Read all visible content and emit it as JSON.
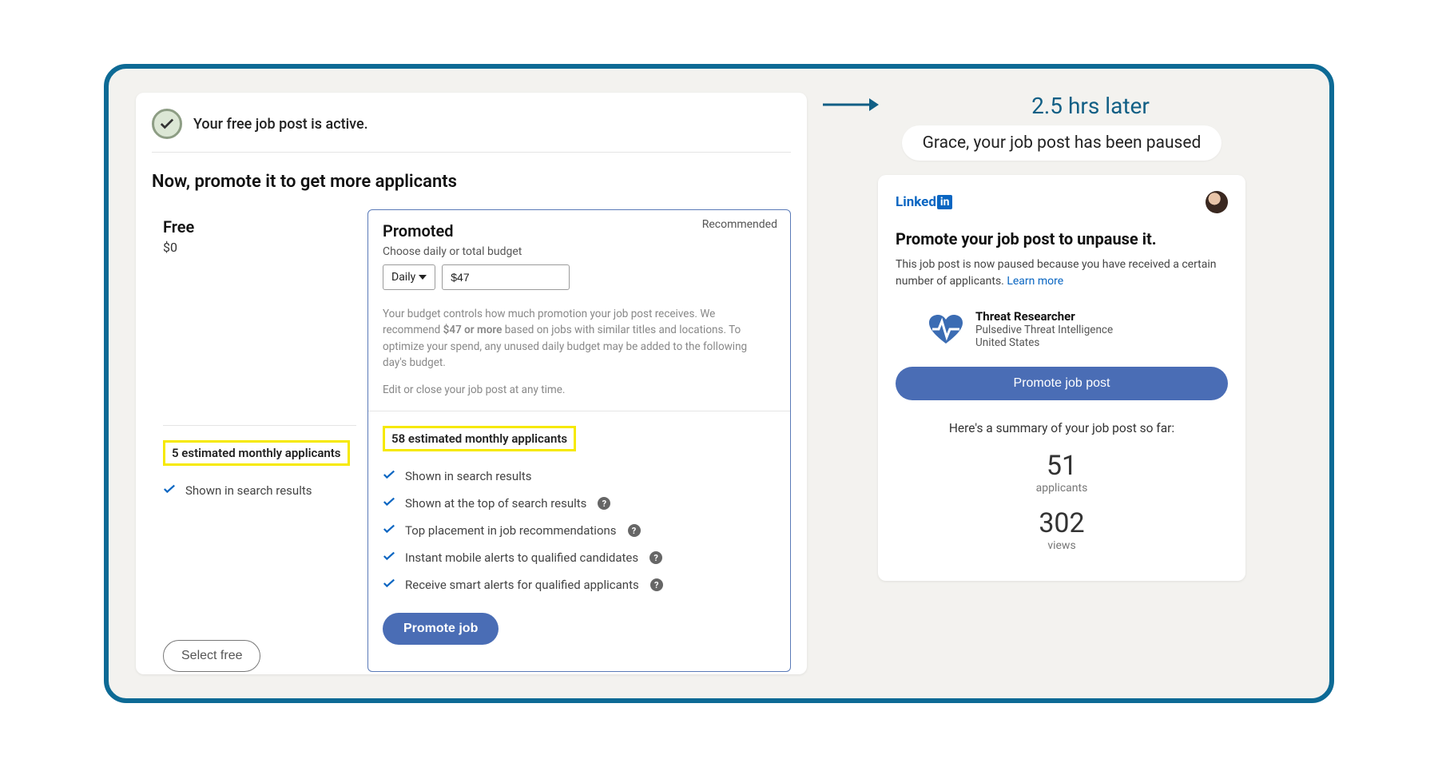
{
  "left": {
    "status_text": "Your free job post is active.",
    "heading": "Now, promote it to get more applicants",
    "free": {
      "title": "Free",
      "price": "$0",
      "estimate": "5 estimated monthly applicants",
      "features": [
        "Shown in search results"
      ],
      "button": "Select free"
    },
    "promoted": {
      "recommended": "Recommended",
      "title": "Promoted",
      "budget_label": "Choose daily or total budget",
      "budget_mode": "Daily",
      "budget_value": "$47",
      "budget_desc_pre": "Your budget controls how much promotion your job post receives. We recommend ",
      "budget_desc_bold": "$47 or more",
      "budget_desc_post": " based on jobs with similar titles and locations. To optimize your spend, any unused daily budget may be added to the following day's budget.",
      "edit_close": "Edit or close your job post at any time.",
      "estimate": "58 estimated monthly applicants",
      "features": [
        "Shown in search results",
        "Shown at the top of search results",
        "Top placement in job recommendations",
        "Instant mobile alerts to qualified candidates",
        "Receive smart alerts for qualified applicants"
      ],
      "button": "Promote job"
    }
  },
  "right": {
    "later": "2.5 hrs later",
    "paused_pill": "Grace, your job post has been paused",
    "logo_linked": "Linked",
    "logo_in": "in",
    "title": "Promote your job post to unpause it.",
    "body": "This job post is now paused because you have received a certain number of applicants. ",
    "learn_more": "Learn more",
    "job": {
      "title": "Threat Researcher",
      "company": "Pulsedive Threat Intelligence",
      "location": "United States"
    },
    "promote_button": "Promote job post",
    "summary_title": "Here's a summary of your job post so far:",
    "stats": {
      "applicants_num": "51",
      "applicants_label": "applicants",
      "views_num": "302",
      "views_label": "views"
    }
  }
}
